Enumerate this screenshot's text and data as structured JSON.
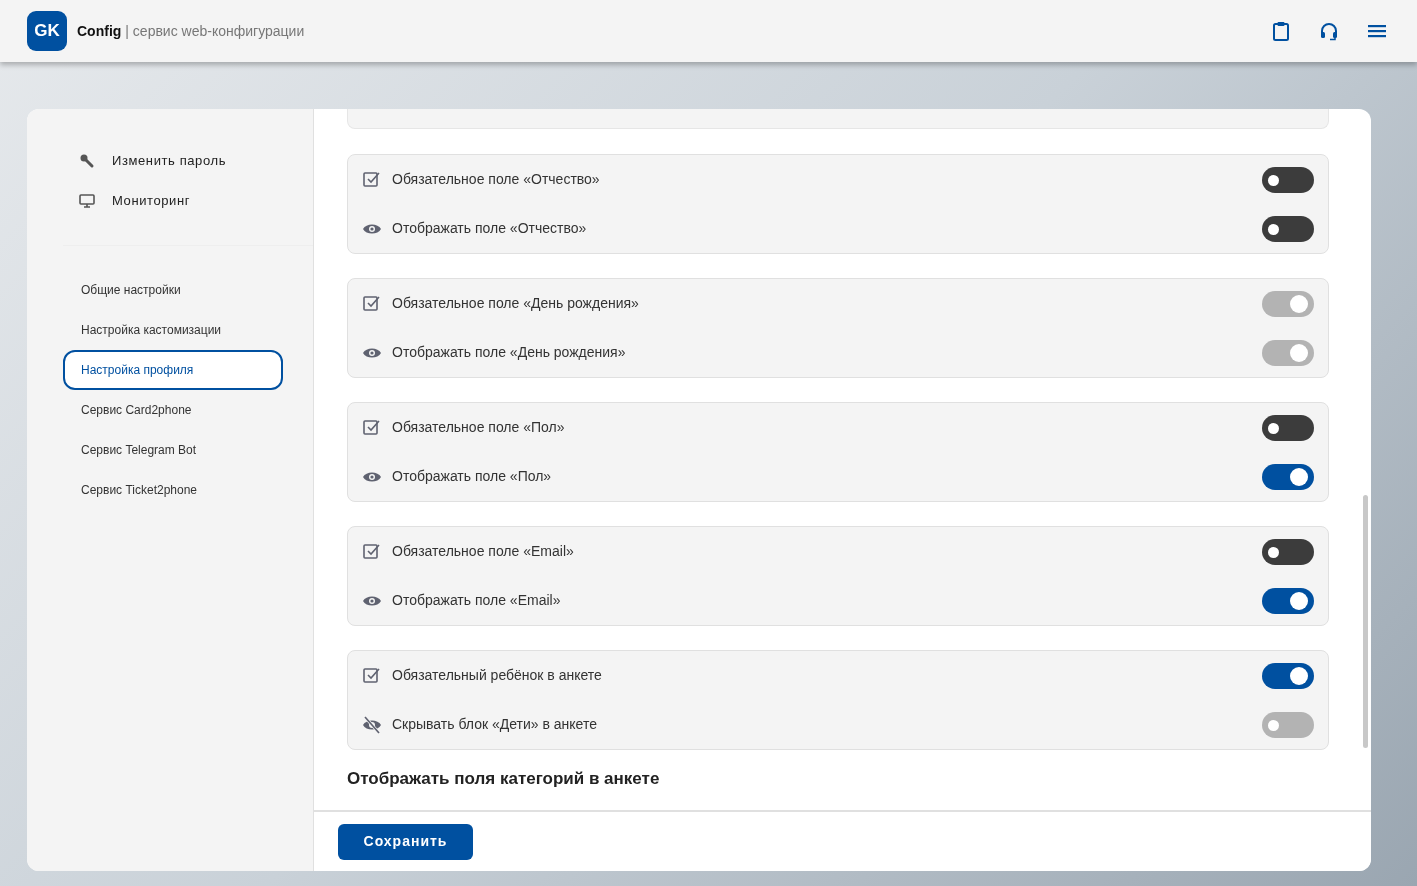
{
  "header": {
    "logo": "GK",
    "app_name": "Config",
    "subtitle": "| сервис web-конфигурации"
  },
  "sidebar": {
    "top_items": [
      {
        "label": "Изменить пароль",
        "kind": "key"
      },
      {
        "label": "Мониторинг",
        "kind": "monitor"
      }
    ],
    "nav_items": [
      {
        "label": "Общие настройки",
        "selected": false
      },
      {
        "label": "Настройка кастомизации",
        "selected": false
      },
      {
        "label": "Настройка профиля",
        "selected": true
      },
      {
        "label": "Сервис Card2phone",
        "selected": false
      },
      {
        "label": "Сервис Telegram Bot",
        "selected": false
      },
      {
        "label": "Сервис Ticket2phone",
        "selected": false
      }
    ]
  },
  "groups": [
    {
      "rows": [
        {
          "kind": "required",
          "label": "Обязательное поле «Отчество»",
          "on": false,
          "disabled": false
        },
        {
          "kind": "visible",
          "label": "Отображать поле «Отчество»",
          "on": false,
          "disabled": false
        }
      ]
    },
    {
      "rows": [
        {
          "kind": "required",
          "label": "Обязательное поле «День рождения»",
          "on": true,
          "disabled": true
        },
        {
          "kind": "visible",
          "label": "Отображать поле «День рождения»",
          "on": true,
          "disabled": true
        }
      ]
    },
    {
      "rows": [
        {
          "kind": "required",
          "label": "Обязательное поле «Пол»",
          "on": false,
          "disabled": false
        },
        {
          "kind": "visible",
          "label": "Отображать поле «Пол»",
          "on": true,
          "disabled": false
        }
      ]
    },
    {
      "rows": [
        {
          "kind": "required",
          "label": "Обязательное поле «Email»",
          "on": false,
          "disabled": false
        },
        {
          "kind": "visible",
          "label": "Отображать поле «Email»",
          "on": true,
          "disabled": false
        }
      ]
    },
    {
      "rows": [
        {
          "kind": "required",
          "label": "Обязательный ребёнок в анкете",
          "on": true,
          "disabled": false
        },
        {
          "kind": "hidden",
          "label": "Скрывать блок «Дети» в анкете",
          "on": false,
          "disabled": true
        }
      ]
    }
  ],
  "section_title": "Отображать поля категорий в анкете",
  "save_button": "Сохранить"
}
